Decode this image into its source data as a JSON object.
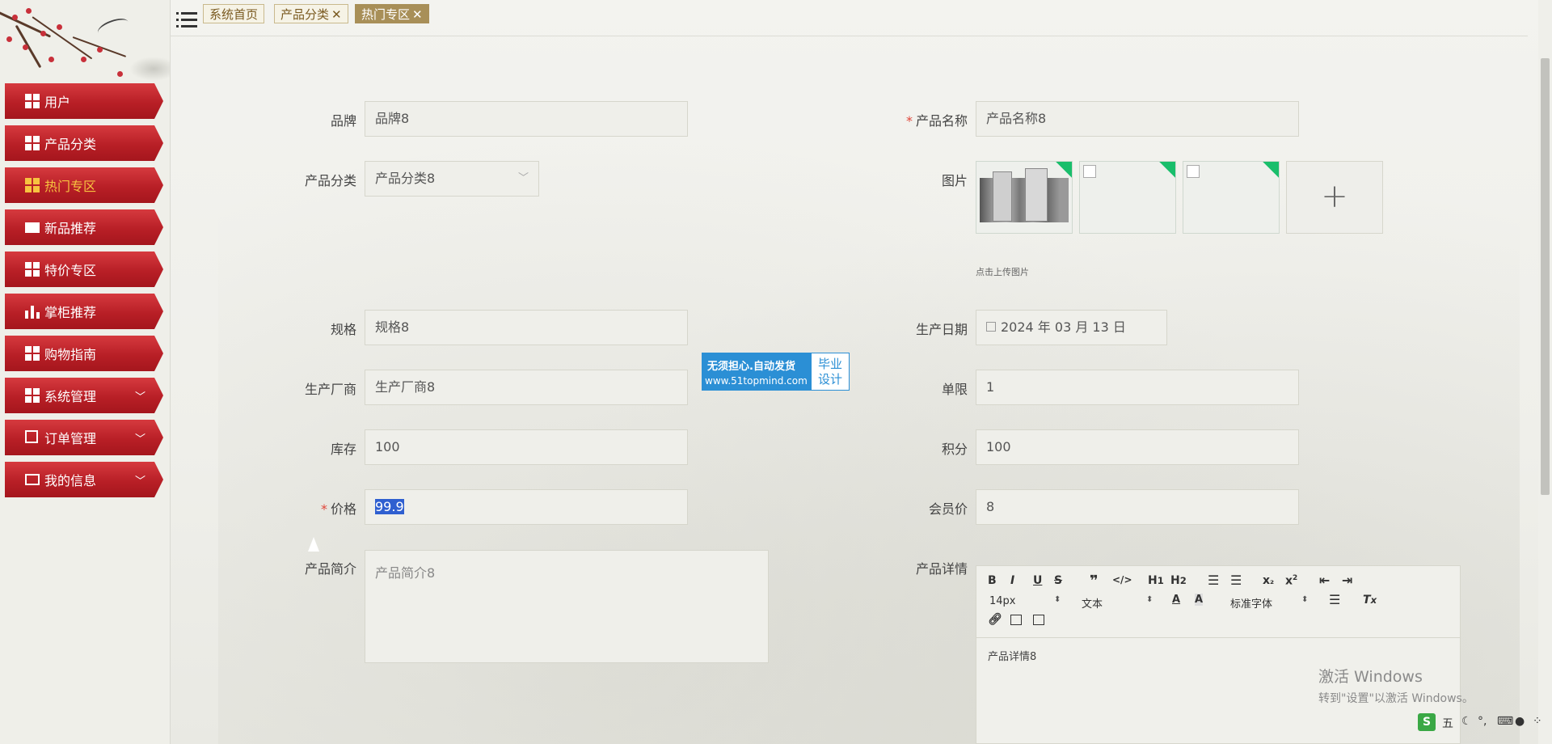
{
  "tabs": [
    {
      "label": "系统首页",
      "closable": false,
      "active": false
    },
    {
      "label": "产品分类",
      "closable": true,
      "active": false
    },
    {
      "label": "热门专区",
      "closable": true,
      "active": true
    }
  ],
  "sidebar": {
    "items": [
      {
        "label": "用户",
        "icon": "grid-icon",
        "active": false,
        "expandable": false
      },
      {
        "label": "产品分类",
        "icon": "grid-icon",
        "active": false,
        "expandable": false
      },
      {
        "label": "热门专区",
        "icon": "grid-icon",
        "active": true,
        "expandable": false
      },
      {
        "label": "新品推荐",
        "icon": "wallet-icon",
        "active": false,
        "expandable": false
      },
      {
        "label": "特价专区",
        "icon": "grid-icon",
        "active": false,
        "expandable": false
      },
      {
        "label": "掌柜推荐",
        "icon": "bar-chart-icon",
        "active": false,
        "expandable": false
      },
      {
        "label": "购物指南",
        "icon": "grid-icon",
        "active": false,
        "expandable": false
      },
      {
        "label": "系统管理",
        "icon": "grid-icon",
        "active": false,
        "expandable": true
      },
      {
        "label": "订单管理",
        "icon": "line-chart-icon",
        "active": false,
        "expandable": true
      },
      {
        "label": "我的信息",
        "icon": "card-icon",
        "active": false,
        "expandable": true
      }
    ]
  },
  "form": {
    "brand": {
      "label": "品牌",
      "value": "品牌8"
    },
    "product_name": {
      "label": "产品名称",
      "value": "产品名称8",
      "required": true
    },
    "category": {
      "label": "产品分类",
      "value": "产品分类8"
    },
    "image": {
      "label": "图片",
      "upload_hint": "点击上传图片",
      "plus": "+"
    },
    "spec": {
      "label": "规格",
      "value": "规格8"
    },
    "production_date": {
      "label": "生产日期",
      "value": "2024 年 03 月 13 日"
    },
    "manufacturer": {
      "label": "生产厂商",
      "value": "生产厂商8"
    },
    "limit": {
      "label": "单限",
      "value": "1"
    },
    "stock": {
      "label": "库存",
      "value": "100"
    },
    "points": {
      "label": "积分",
      "value": "100"
    },
    "price": {
      "label": "价格",
      "value": "99.9",
      "required": true
    },
    "member_price": {
      "label": "会员价",
      "value": "8"
    },
    "intro": {
      "label": "产品简介",
      "value": "产品简介8"
    },
    "detail": {
      "label": "产品详情",
      "value": "产品详情8",
      "font_size": "14px",
      "text_type": "文本",
      "font_family": "标准字体"
    }
  },
  "watermark": {
    "line1": "无须担心.自动发货",
    "line2": "www.51topmind.com",
    "side1": "毕业",
    "side2": "设计"
  },
  "activation": {
    "title": "激活 Windows",
    "subtitle": "转到\"设置\"以激活 Windows。"
  },
  "taskbar": {
    "ime": "五"
  },
  "colors": {
    "menu_red": "#c0272d",
    "active_text": "#f7c340",
    "tab_active": "#a88f58",
    "required": "#e0463a"
  }
}
